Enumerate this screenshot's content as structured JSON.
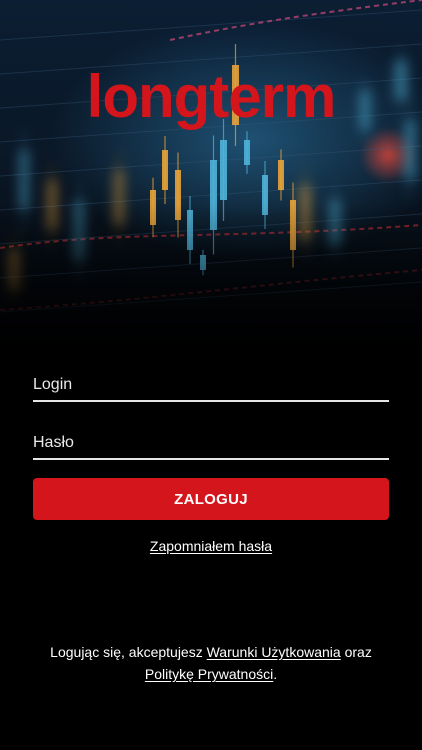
{
  "app": {
    "logo_text": "longterm",
    "brand_color": "#d4151b",
    "background_color": "#000000"
  },
  "form": {
    "login_placeholder": "Login",
    "login_value": "",
    "password_placeholder": "Hasło",
    "password_value": "",
    "submit_label": "ZALOGUJ",
    "forgot_password_label": "Zapomniałem hasła"
  },
  "legal": {
    "prefix": "Logując się, akceptujesz ",
    "terms_link": "Warunki Użytkowania",
    "middle": " oraz ",
    "privacy_link": "Politykę Prywatności",
    "suffix": "."
  },
  "hero": {
    "description_icon": "candlestick-chart-icon",
    "bull_color": "#4fb3d9",
    "bear_color": "#e8a33a",
    "accent_color": "#d8343a"
  }
}
